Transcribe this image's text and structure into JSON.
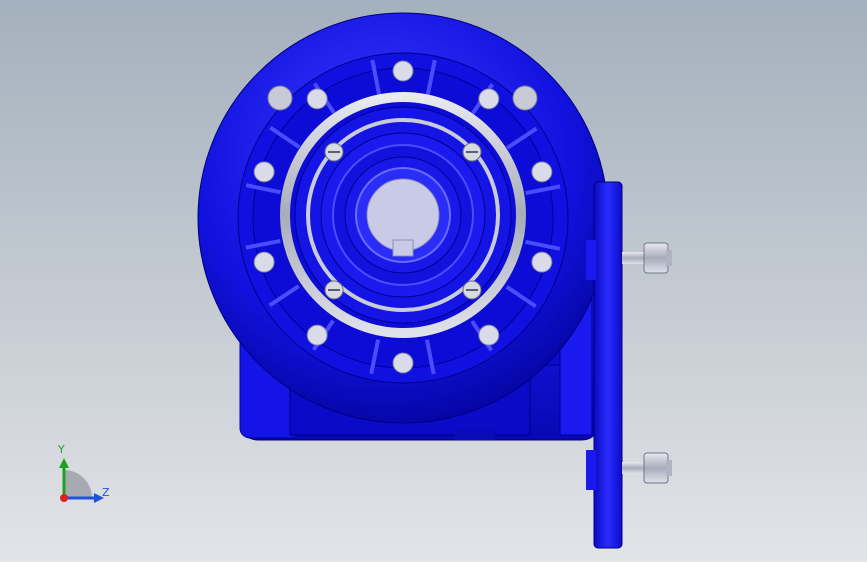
{
  "viewport": {
    "background_top": "#a3b0bd",
    "background_bottom": "#e2e4e8",
    "model": {
      "body_color": "#1010e6",
      "body_dark": "#0000a8",
      "body_light": "#4a4cff",
      "steel_color": "#c8ccd8",
      "bolt_color": "#d8dae2"
    }
  },
  "triad": {
    "y_label": "Y",
    "z_label": "Z",
    "x_color": "#e02020",
    "y_color": "#20a020",
    "z_color": "#2050e0"
  }
}
